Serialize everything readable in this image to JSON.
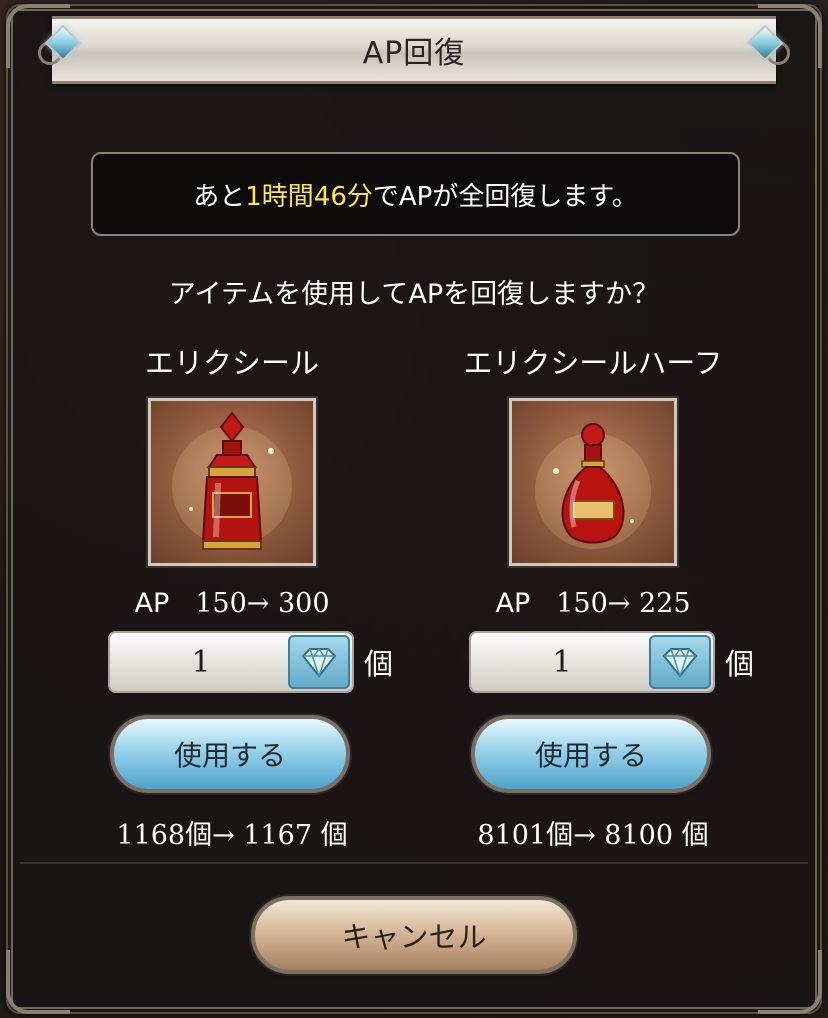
{
  "dialog": {
    "title": "AP回復",
    "info": {
      "prefix": "あと",
      "time": "1時間46分",
      "suffix": "でAPが全回復します。"
    },
    "prompt": "アイテムを使用してAPを回復しますか？",
    "items": [
      {
        "name": "エリクシール",
        "icon": "elixir-bottle-icon",
        "ap_label": "AP",
        "ap_change": "150→ 300",
        "quantity": "1",
        "unit": "個",
        "use_label": "使用する",
        "count_change": "1168個→ 1167",
        "count_unit": "個"
      },
      {
        "name": "エリクシールハーフ",
        "icon": "half-elixir-bottle-icon",
        "ap_label": "AP",
        "ap_change": "150→ 225",
        "quantity": "1",
        "unit": "個",
        "use_label": "使用する",
        "count_change": "8101個→ 8100",
        "count_unit": "個"
      }
    ],
    "cancel_label": "キャンセル"
  },
  "colors": {
    "highlight": "#ffe84a",
    "button_blue": "#9fd6ee",
    "button_tan": "#d6b999"
  }
}
